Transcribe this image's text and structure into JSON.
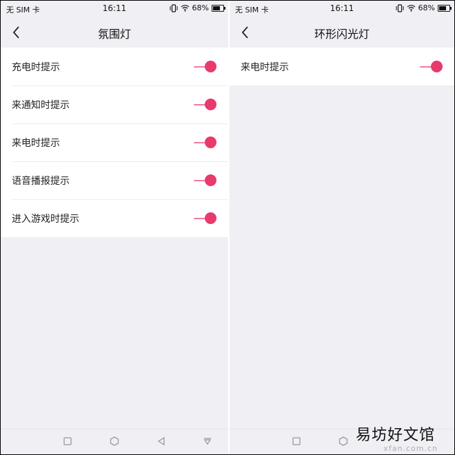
{
  "status": {
    "carrier": "无 SIM 卡",
    "time": "16:11",
    "battery": "68%",
    "battery_level": 0.68
  },
  "left": {
    "title": "氛围灯",
    "items": [
      {
        "label": "充电时提示",
        "on": true
      },
      {
        "label": "来通知时提示",
        "on": true
      },
      {
        "label": "来电时提示",
        "on": true
      },
      {
        "label": "语音播报提示",
        "on": true
      },
      {
        "label": "进入游戏时提示",
        "on": true
      }
    ]
  },
  "right": {
    "title": "环形闪光灯",
    "items": [
      {
        "label": "来电时提示",
        "on": true
      }
    ]
  },
  "icons": [
    "back-arrow-icon",
    "vibrate-icon",
    "wifi-icon",
    "battery-icon",
    "square-icon",
    "hexagon-icon",
    "triangle-back-icon",
    "down-triangle-icon"
  ],
  "colors": {
    "accent": "#e83a6b",
    "track": "#f07aa0",
    "background": "#efeff4"
  },
  "watermark": {
    "text": "易坊好文馆",
    "sub": "xfan.com.cn"
  }
}
